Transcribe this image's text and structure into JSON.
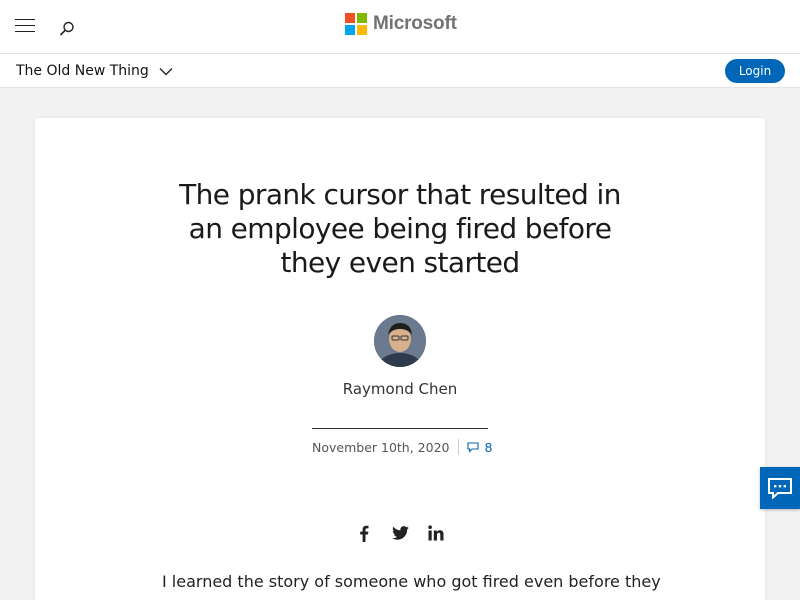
{
  "header": {
    "brand": "Microsoft",
    "menu_icon": "hamburger-menu-icon",
    "search_icon": "search-icon",
    "logo_colors": [
      "#f25022",
      "#7fba00",
      "#00a4ef",
      "#ffb900"
    ]
  },
  "subnav": {
    "blog_title": "The Old New Thing",
    "dropdown_icon": "chevron-down-icon",
    "login_label": "Login"
  },
  "post": {
    "title": "The prank cursor that resulted in an employee being fired before they even started",
    "author": "Raymond Chen",
    "date": "November 10th, 2020",
    "comment_count": "8",
    "comment_icon": "comment-icon",
    "share_icons": [
      "facebook-icon",
      "twitter-icon",
      "linkedin-icon"
    ],
    "lead_text": "I learned the story of someone who got fired even before they"
  },
  "feedback": {
    "icon": "feedback-chat-icon"
  },
  "colors": {
    "accent": "#0067b8",
    "background": "#f2f2f2"
  }
}
